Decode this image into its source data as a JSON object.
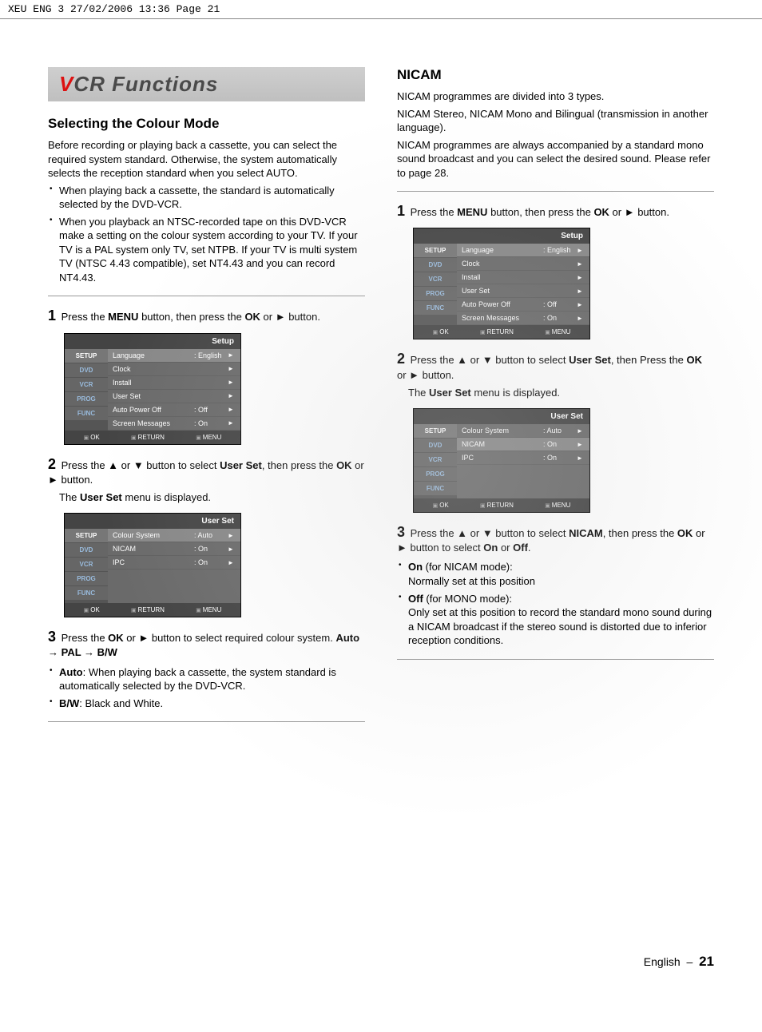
{
  "crop_header": "XEU ENG 3   27/02/2006  13:36  Page 21",
  "title_band_v": "V",
  "title_band_rest": "CR Functions",
  "left": {
    "section_heading": "Selecting the Colour Mode",
    "intro": "Before recording or playing back a cassette, you can select the required system standard. Otherwise, the system automatically selects the reception standard when you select AUTO.",
    "bullets": [
      "When playing back a cassette, the standard is automatically selected by the DVD-VCR.",
      "When you playback an NTSC-recorded tape on this DVD-VCR make a setting on the colour system according to your TV. If your TV is a PAL  system only TV, set NTPB. If your TV is multi   system TV (NTSC 4.43 compatible), set NT4.43 and you can record NT4.43."
    ],
    "step1_num": "1",
    "step1_a": "Press the ",
    "step1_b": "MENU",
    "step1_c": " button, then press the ",
    "step1_d": "OK",
    "step1_e": " or ► button.",
    "step2_num": "2",
    "step2_a": "Press the ▲ or ▼ button to select ",
    "step2_b": "User Set",
    "step2_c": ", then press the ",
    "step2_d": "OK",
    "step2_e": " or ► button.",
    "step2_f_a": "The ",
    "step2_f_b": "User Set",
    "step2_f_c": " menu is displayed.",
    "step3_num": "3",
    "step3_a": "Press the ",
    "step3_b": "OK",
    "step3_c": " or ► button to select required colour system. ",
    "step3_d": "Auto → PAL →  B/W",
    "step3_sub1_lead": "Auto",
    "step3_sub1_rest": ": When playing back a cassette, the system standard is automatically selected by the DVD-VCR.",
    "step3_sub2_lead": "B/W",
    "step3_sub2_rest": ": Black and White."
  },
  "right": {
    "section_heading": "NICAM",
    "intro_line1": "NICAM programmes are divided into 3 types.",
    "intro_line2": "NICAM Stereo, NICAM Mono and Bilingual (transmission in another language).",
    "intro_line3": "NICAM programmes are always accompanied by a standard mono sound broadcast and you can select the desired sound. Please refer to page 28.",
    "step1_num": "1",
    "step1_a": "Press the ",
    "step1_b": "MENU",
    "step1_c": " button, then press the ",
    "step1_d": "OK",
    "step1_e": " or ► button.",
    "step2_num": "2",
    "step2_a": "Press the ▲ or ▼ button to select ",
    "step2_b": "User Set",
    "step2_c": ", then Press the ",
    "step2_d": "OK",
    "step2_e": " or ► button.",
    "step2_f_a": "The  ",
    "step2_f_b": "User Set",
    "step2_f_c": " menu is displayed.",
    "step3_num": "3",
    "step3_a": "Press the ▲ or ▼ button to select ",
    "step3_b": "NICAM",
    "step3_c": ", then press the ",
    "step3_d": "OK",
    "step3_e": " or ► button to select ",
    "step3_f": "On",
    "step3_g": " or ",
    "step3_h": "Off",
    "step3_i": ".",
    "step3_sub1_lead": "On",
    "step3_sub1_mid": " (for NICAM mode):",
    "step3_sub1_rest": "Normally set at this position",
    "step3_sub2_lead": "Off",
    "step3_sub2_mid": " (for MONO mode):",
    "step3_sub2_rest": "Only set at this position to record the standard mono sound during a NICAM broadcast if the stereo sound is distorted due to inferior reception conditions."
  },
  "osd_setup": {
    "title": "Setup",
    "side": [
      "SETUP",
      "DVD",
      "VCR",
      "PROG",
      "FUNC"
    ],
    "rows": [
      {
        "l": "Language",
        "v": ": English",
        "a": "►"
      },
      {
        "l": "Clock",
        "v": "",
        "a": "►"
      },
      {
        "l": "Install",
        "v": "",
        "a": "►"
      },
      {
        "l": "User Set",
        "v": "",
        "a": "►"
      },
      {
        "l": "Auto Power Off",
        "v": ": Off",
        "a": "►"
      },
      {
        "l": "Screen Messages",
        "v": ": On",
        "a": "►"
      }
    ],
    "foot": [
      "OK",
      "RETURN",
      "MENU"
    ]
  },
  "osd_userset": {
    "title": "User Set",
    "side": [
      "SETUP",
      "DVD",
      "VCR",
      "PROG",
      "FUNC"
    ],
    "rows": [
      {
        "l": "Colour System",
        "v": ": Auto",
        "a": "►",
        "hl": true
      },
      {
        "l": "NICAM",
        "v": ": On",
        "a": "►"
      },
      {
        "l": "IPC",
        "v": ": On",
        "a": "►"
      }
    ],
    "foot": [
      "OK",
      "RETURN",
      "MENU"
    ]
  },
  "osd_userset_nicam": {
    "title": "User Set",
    "side": [
      "SETUP",
      "DVD",
      "VCR",
      "PROG",
      "FUNC"
    ],
    "rows": [
      {
        "l": "Colour System",
        "v": ": Auto",
        "a": "►"
      },
      {
        "l": "NICAM",
        "v": ": On",
        "a": "►",
        "hl": true
      },
      {
        "l": "IPC",
        "v": ": On",
        "a": "►"
      }
    ],
    "foot": [
      "OK",
      "RETURN",
      "MENU"
    ]
  },
  "footer_lang": "English",
  "footer_dash": "–",
  "footer_page": "21"
}
